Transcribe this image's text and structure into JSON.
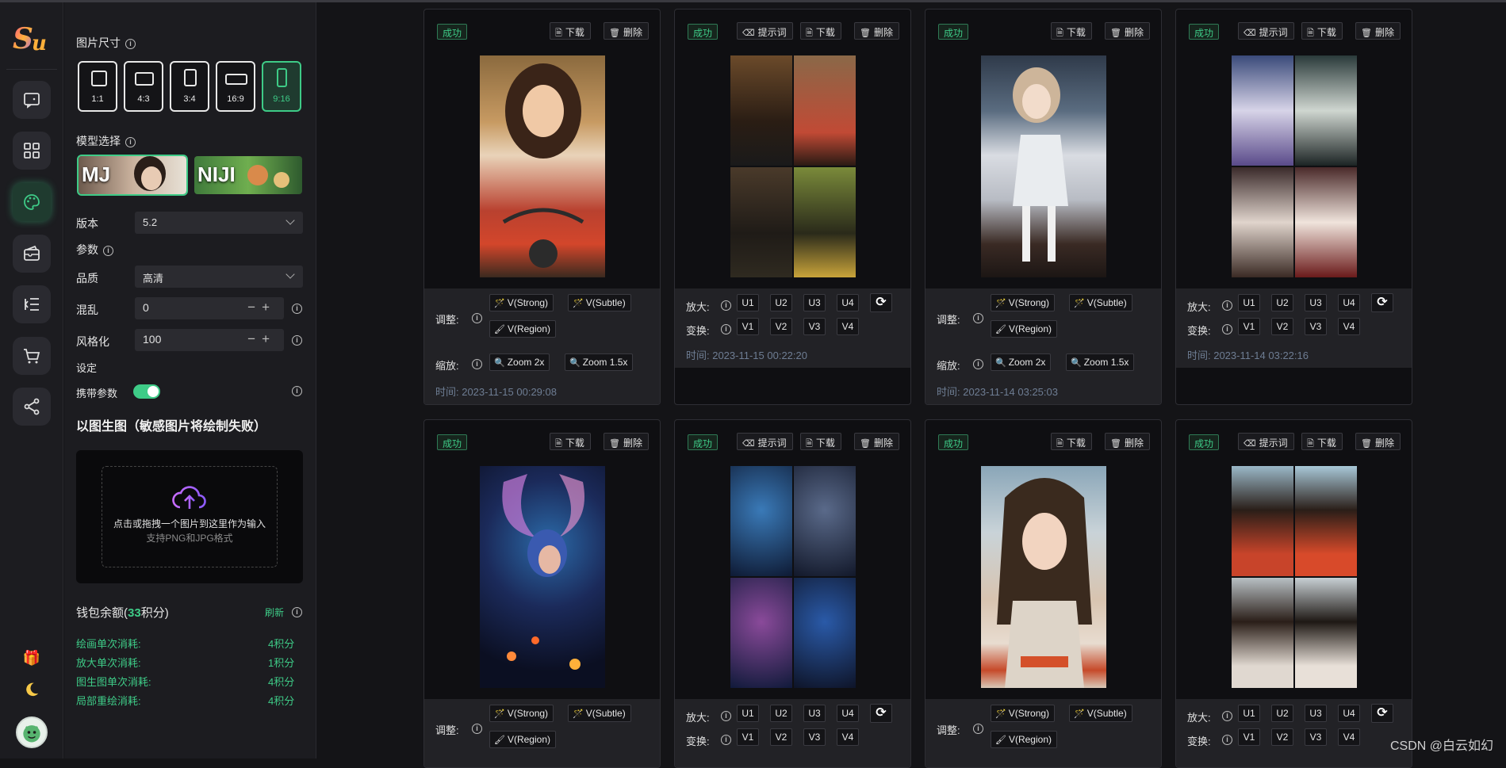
{
  "sidebar": {
    "logo_text": "Su",
    "nav": [
      "chat",
      "apps",
      "draw",
      "wallet",
      "menu",
      "cart",
      "share"
    ],
    "mini": [
      "gift-icon",
      "moon-icon"
    ]
  },
  "panel": {
    "size_label": "图片尺寸",
    "ratios": [
      "1:1",
      "4:3",
      "3:4",
      "16:9",
      "9:16"
    ],
    "active_ratio": "9:16",
    "model_label": "模型选择",
    "models": [
      "MJ",
      "NIJI"
    ],
    "active_model": "MJ",
    "version_label": "版本",
    "version_value": "5.2",
    "params_label": "参数",
    "quality_label": "品质",
    "quality_value": "高清",
    "chaos_label": "混乱",
    "chaos_value": "0",
    "stylize_label": "风格化",
    "stylize_value": "100",
    "settings_label": "设定",
    "carry_label": "携带参数",
    "carry_on": true,
    "img2img_title": "以图生图（敏感图片将绘制失败）",
    "upload_text": "点击或拖拽一个图片到这里作为输入",
    "upload_hint": "支持PNG和JPG格式",
    "wallet_prefix": "钱包余额(",
    "wallet_points": "33",
    "wallet_suffix": "积分)",
    "refresh_label": "刷新",
    "costs": [
      {
        "label": "绘画单次消耗:",
        "value": "4积分"
      },
      {
        "label": "放大单次消耗:",
        "value": "1积分"
      },
      {
        "label": "图生图单次消耗:",
        "value": "4积分"
      },
      {
        "label": "局部重绘消耗:",
        "value": "4积分"
      }
    ]
  },
  "cards_common": {
    "status": "成功",
    "prompt_btn": "提示词",
    "download_btn": "下载",
    "delete_btn": "删除",
    "adjust_label": "调整:",
    "zoom_label": "缩放:",
    "upscale_label": "放大:",
    "variation_label": "变换:",
    "v_strong": "V(Strong)",
    "v_subtle": "V(Subtle)",
    "v_region": "V(Region)",
    "zoom2": "Zoom 2x",
    "zoom15": "Zoom 1.5x",
    "u": [
      "U1",
      "U2",
      "U3",
      "U4"
    ],
    "v": [
      "V1",
      "V2",
      "V3",
      "V4"
    ]
  },
  "times": {
    "c1": "时间:  2023-11-15 00:29:08",
    "c2": "时间:  2023-11-15 00:22:20",
    "c3": "时间:  2023-11-14 03:25:03",
    "c4": "时间:  2023-11-14 03:22:16"
  },
  "colors": {
    "accent": "#3ecb87",
    "bg": "#141417",
    "panel": "#1c1c20"
  },
  "watermark": "CSDN @白云如幻"
}
